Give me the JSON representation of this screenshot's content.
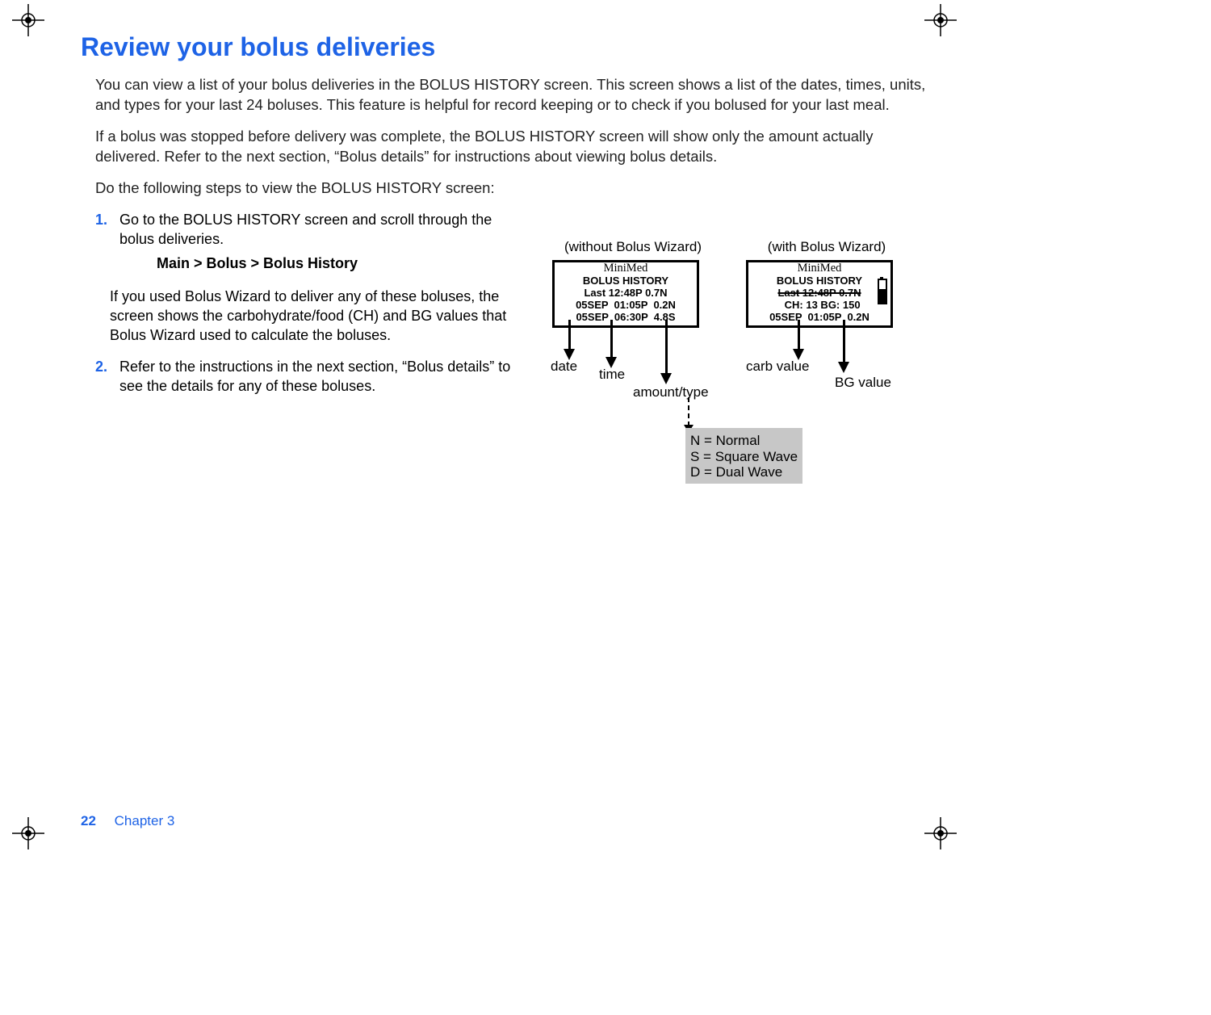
{
  "heading": "Review your bolus deliveries",
  "paragraphs": {
    "p1": "You can view a list of your bolus deliveries in the BOLUS HISTORY screen. This screen shows a list of the dates, times, units, and types for your last 24 boluses. This feature is helpful for record keeping or to check if you bolused for your last meal.",
    "p2": "If a bolus was stopped before delivery was complete, the BOLUS HISTORY screen will show only the amount actually delivered. Refer to the next section, “Bolus details” for instructions about viewing bolus details.",
    "p3": "Do the following steps to view the BOLUS HISTORY screen:"
  },
  "steps": {
    "s1": "Go to the BOLUS HISTORY screen and scroll through the bolus deliveries.",
    "nav_path": "Main > Bolus > Bolus History",
    "note": "If you used Bolus Wizard to deliver any of these boluses, the screen shows the carbohydrate/food (CH) and BG values that Bolus Wizard used to calculate the boluses.",
    "s2": "Refer to the instructions in the next section, “Bolus details” to see the details for any of these boluses."
  },
  "diagram": {
    "title_left": "(without Bolus Wizard)",
    "title_right": "(with Bolus Wizard)",
    "brand": "MiniMed",
    "lcd_left": {
      "line1": "BOLUS HISTORY",
      "line2": "Last 12:48P 0.7N",
      "line3": "05SEP  01:05P  0.2N",
      "line4": "05SEP  06:30P  4.8S"
    },
    "lcd_right": {
      "line1": "BOLUS HISTORY",
      "line2": "Last 12:48P 0.7N",
      "line2_struck": true,
      "line3": "  CH: 13 BG: 150",
      "line4": "05SEP  01:05P  0.2N"
    },
    "labels": {
      "date": "date",
      "time": "time",
      "amount": "amount/type",
      "carb": "carb value",
      "bg": "BG value"
    },
    "legend": {
      "n": "N = Normal",
      "s": "S = Square Wave",
      "d": "D = Dual Wave"
    }
  },
  "footer": {
    "page_number": "22",
    "chapter": "Chapter 3"
  }
}
